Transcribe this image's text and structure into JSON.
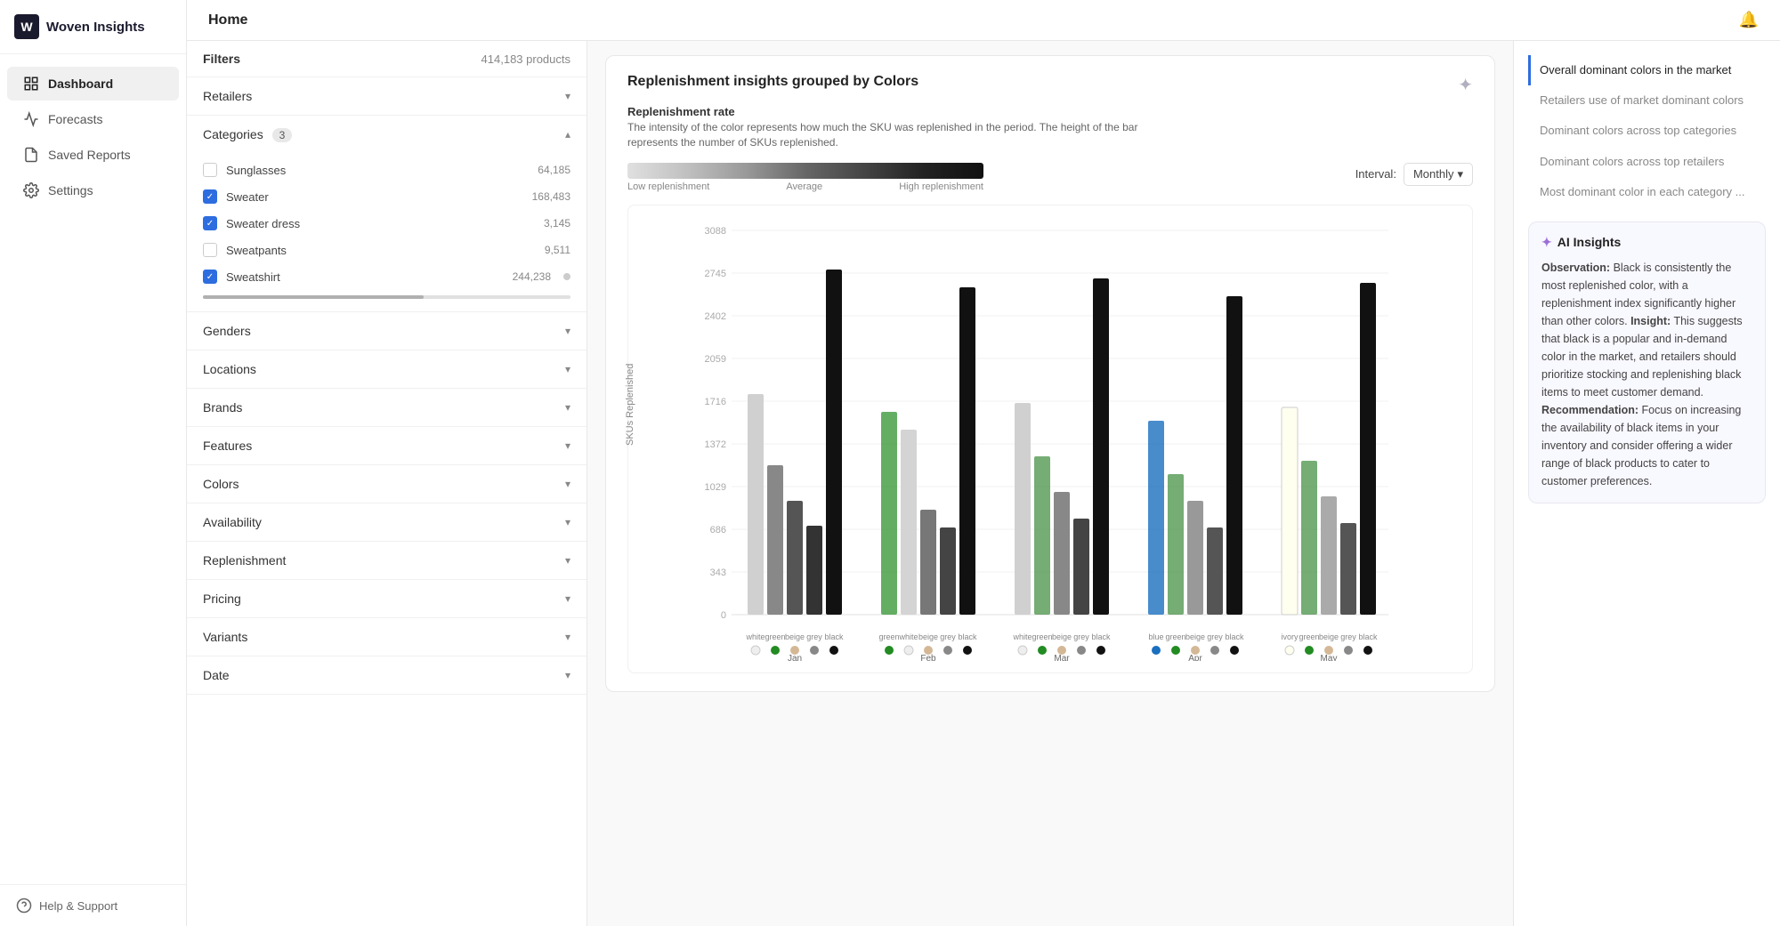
{
  "sidebar": {
    "logo_text": "Woven Insights",
    "items": [
      {
        "id": "dashboard",
        "label": "Dashboard",
        "active": true
      },
      {
        "id": "forecasts",
        "label": "Forecasts",
        "active": false
      },
      {
        "id": "saved-reports",
        "label": "Saved Reports",
        "active": false
      },
      {
        "id": "settings",
        "label": "Settings",
        "active": false
      }
    ],
    "footer": {
      "label": "Help & Support"
    }
  },
  "header": {
    "title": "Home"
  },
  "filters": {
    "label": "Filters",
    "count": "414,183 products",
    "sections": [
      {
        "id": "retailers",
        "label": "Retailers",
        "badge": null,
        "expanded": false
      },
      {
        "id": "categories",
        "label": "Categories",
        "badge": "3",
        "expanded": true
      },
      {
        "id": "genders",
        "label": "Genders",
        "badge": null,
        "expanded": false
      },
      {
        "id": "locations",
        "label": "Locations",
        "badge": null,
        "expanded": false
      },
      {
        "id": "brands",
        "label": "Brands",
        "badge": null,
        "expanded": false
      },
      {
        "id": "features",
        "label": "Features",
        "badge": null,
        "expanded": false
      },
      {
        "id": "colors",
        "label": "Colors",
        "badge": null,
        "expanded": false
      },
      {
        "id": "availability",
        "label": "Availability",
        "badge": null,
        "expanded": false
      },
      {
        "id": "replenishment",
        "label": "Replenishment",
        "badge": null,
        "expanded": false
      },
      {
        "id": "pricing",
        "label": "Pricing",
        "badge": null,
        "expanded": false
      },
      {
        "id": "variants",
        "label": "Variants",
        "badge": null,
        "expanded": false
      },
      {
        "id": "date",
        "label": "Date",
        "badge": null,
        "expanded": false
      }
    ],
    "categories": [
      {
        "name": "Sunglasses",
        "count": "64,185",
        "checked": false
      },
      {
        "name": "Sweater",
        "count": "168,483",
        "checked": true
      },
      {
        "name": "Sweater dress",
        "count": "3,145",
        "checked": true
      },
      {
        "name": "Sweatpants",
        "count": "9,511",
        "checked": false
      },
      {
        "name": "Sweatshirt",
        "count": "244,238",
        "checked": true
      }
    ]
  },
  "chart": {
    "title": "Replenishment insights grouped by Colors",
    "rate_label": "Replenishment rate",
    "rate_desc": "The intensity of the color represents how much the SKU was replenished in the period. The height of the bar represents the number of SKUs replenished.",
    "legend_low": "Low replenishment",
    "legend_avg": "Average",
    "legend_high": "High replenishment",
    "interval_label": "Interval:",
    "interval_value": "Monthly",
    "y_axis_label": "SKUs Replenished",
    "y_ticks": [
      "3088",
      "2745",
      "2402",
      "2059",
      "1716",
      "1372",
      "1029",
      "686",
      "343",
      "0"
    ],
    "months": [
      "Jan",
      "Feb",
      "Mar",
      "Apr",
      "May"
    ],
    "month_data": [
      {
        "month": "Jan",
        "colors": [
          "white",
          "green",
          "beige",
          "grey",
          "black"
        ],
        "dots": [
          "#fff",
          "#228b22",
          "#d4b896",
          "#888",
          "#111"
        ]
      },
      {
        "month": "Feb",
        "colors": [
          "green",
          "white",
          "beige",
          "grey",
          "black"
        ],
        "dots": [
          "#228b22",
          "#fff",
          "#d4b896",
          "#888",
          "#111"
        ]
      },
      {
        "month": "Mar",
        "colors": [
          "white",
          "green",
          "beige",
          "grey",
          "black"
        ],
        "dots": [
          "#fff",
          "#228b22",
          "#d4b896",
          "#888",
          "#111"
        ]
      },
      {
        "month": "Apr",
        "colors": [
          "blue",
          "green",
          "beige",
          "grey",
          "black"
        ],
        "dots": [
          "#1a6fbf",
          "#228b22",
          "#d4b896",
          "#888",
          "#111"
        ]
      },
      {
        "month": "May",
        "colors": [
          "ivory",
          "green",
          "beige",
          "grey",
          "black"
        ],
        "dots": [
          "#fffff0",
          "#228b22",
          "#d4b896",
          "#888",
          "#111"
        ]
      }
    ]
  },
  "toc": {
    "items": [
      {
        "id": "overall",
        "label": "Overall dominant colors in the market",
        "active": true
      },
      {
        "id": "retailers-use",
        "label": "Retailers use of market dominant colors",
        "active": false
      },
      {
        "id": "dominant-categories",
        "label": "Dominant colors across top categories",
        "active": false
      },
      {
        "id": "dominant-retailers",
        "label": "Dominant colors across top retailers",
        "active": false
      },
      {
        "id": "most-dominant",
        "label": "Most dominant color in each category ...",
        "active": false
      }
    ]
  },
  "ai_insights": {
    "title": "AI Insights",
    "body": "**Observation:** Black is consistently the most replenished color, with a replenishment index significantly higher than other colors. **Insight:** This suggests that black is a popular and in-demand color in the market, and retailers should prioritize stocking and replenishing black items to meet customer demand.\n**Recommendation:** Focus on increasing the availability of black items in your inventory and consider offering a wider range of black products to cater to customer preferences."
  }
}
